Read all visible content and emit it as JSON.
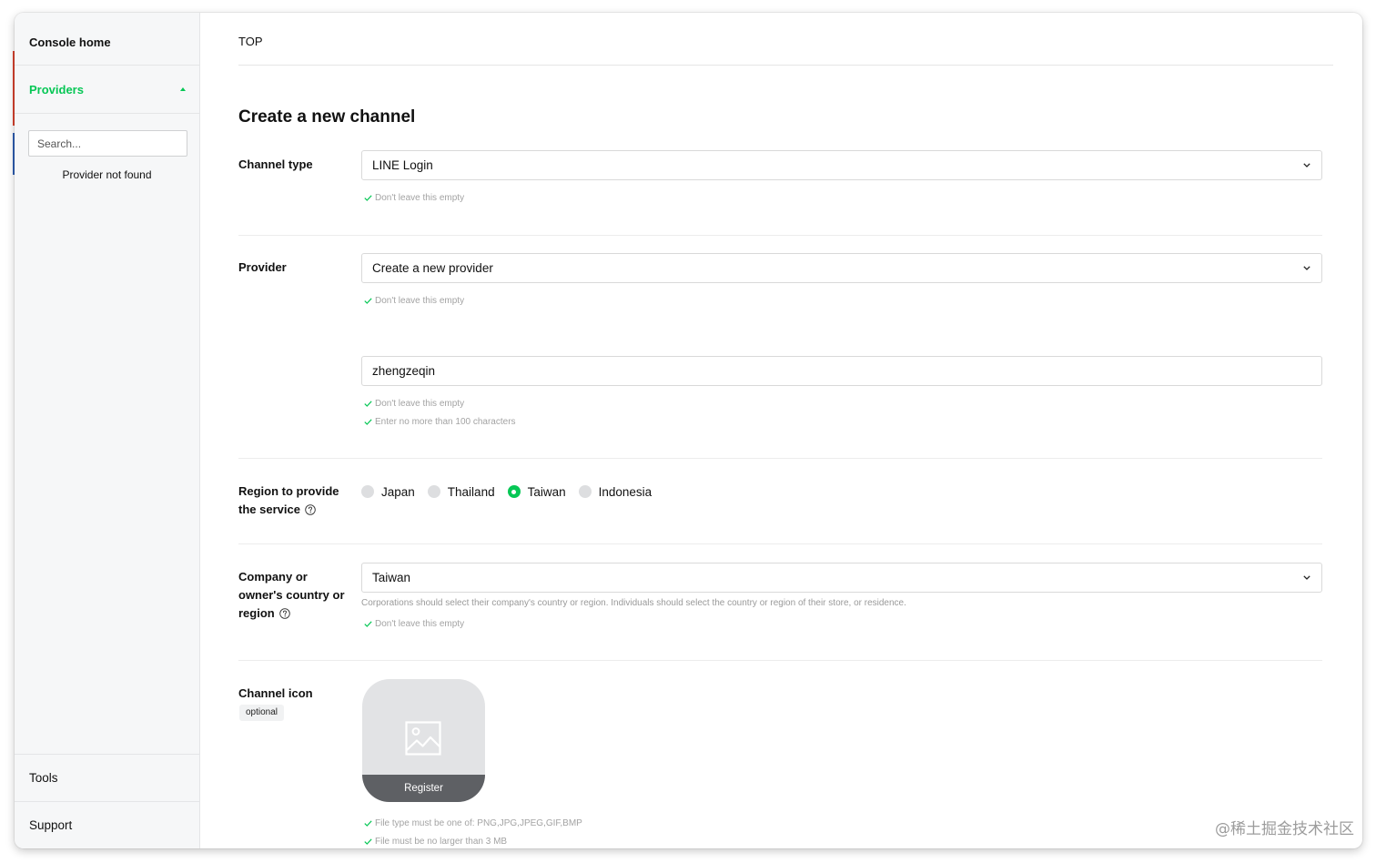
{
  "sidebar": {
    "console_home": "Console home",
    "providers": "Providers",
    "search_placeholder": "Search...",
    "empty_message": "Provider not found",
    "footer_items": [
      "Tools",
      "Support"
    ]
  },
  "breadcrumb": [
    "TOP"
  ],
  "page_title": "Create a new channel",
  "form": {
    "channel_type": {
      "label": "Channel type",
      "value": "LINE Login",
      "checks": [
        "Don't leave this empty"
      ]
    },
    "provider": {
      "label": "Provider",
      "value": "Create a new provider",
      "checks": [
        "Don't leave this empty"
      ],
      "name_value": "zhengzeqin",
      "name_checks": [
        "Don't leave this empty",
        "Enter no more than 100 characters"
      ]
    },
    "region": {
      "label": "Region to provide the service",
      "options": [
        {
          "label": "Japan",
          "selected": false
        },
        {
          "label": "Thailand",
          "selected": false
        },
        {
          "label": "Taiwan",
          "selected": true
        },
        {
          "label": "Indonesia",
          "selected": false
        }
      ]
    },
    "company_country": {
      "label": "Company or owner's country or region",
      "value": "Taiwan",
      "help": "Corporations should select their company's country or region. Individuals should select the country or region of their store, or residence.",
      "checks": [
        "Don't leave this empty"
      ]
    },
    "channel_icon": {
      "label": "Channel icon",
      "badge": "optional",
      "button": "Register",
      "checks": [
        "File type must be one of: PNG,JPG,JPEG,GIF,BMP",
        "File must be no larger than 3 MB"
      ]
    }
  },
  "watermark": "@稀土掘金技术社区",
  "colors": {
    "accent": "#06c755"
  },
  "icons": {
    "providers_toggle": "caret-up-icon",
    "select_arrow": "chevron-down-icon",
    "validation": "check-icon",
    "help": "help-icon",
    "icon_placeholder": "image-icon"
  }
}
